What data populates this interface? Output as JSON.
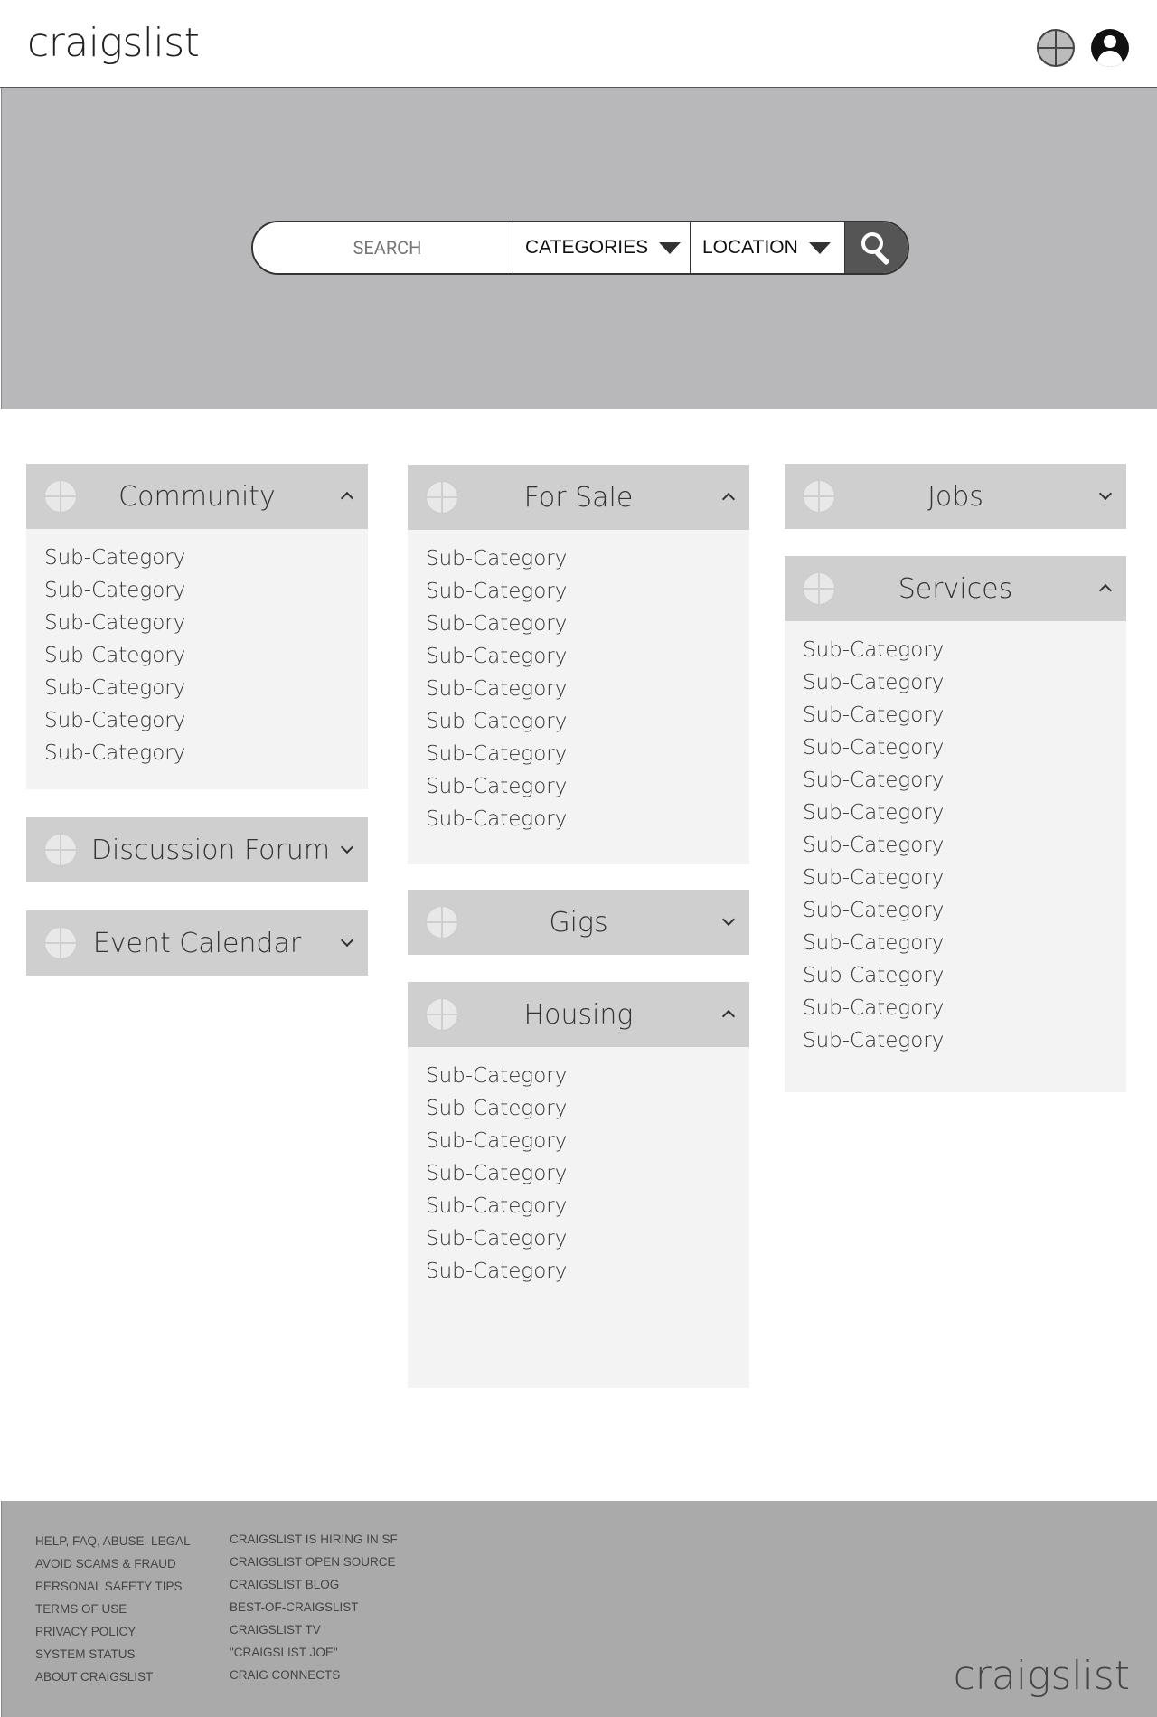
{
  "header": {
    "logo": "craigslist"
  },
  "search": {
    "placeholder": "SEARCH",
    "categories_label": "CATEGORIES",
    "location_label": "LOCATION"
  },
  "panels": {
    "community": {
      "title": "Community",
      "expanded": true,
      "items": [
        "Sub-Category",
        "Sub-Category",
        "Sub-Category",
        "Sub-Category",
        "Sub-Category",
        "Sub-Category",
        "Sub-Category"
      ]
    },
    "discussion_forum": {
      "title": "Discussion Forum",
      "expanded": false
    },
    "event_calendar": {
      "title": "Event Calendar",
      "expanded": false
    },
    "for_sale": {
      "title": "For Sale",
      "expanded": true,
      "items": [
        "Sub-Category",
        "Sub-Category",
        "Sub-Category",
        "Sub-Category",
        "Sub-Category",
        "Sub-Category",
        "Sub-Category",
        "Sub-Category",
        "Sub-Category"
      ]
    },
    "gigs": {
      "title": "Gigs",
      "expanded": false
    },
    "housing": {
      "title": "Housing",
      "expanded": true,
      "items": [
        "Sub-Category",
        "Sub-Category",
        "Sub-Category",
        "Sub-Category",
        "Sub-Category",
        "Sub-Category",
        "Sub-Category"
      ]
    },
    "jobs": {
      "title": "Jobs",
      "expanded": false
    },
    "services": {
      "title": "Services",
      "expanded": true,
      "items": [
        "Sub-Category",
        "Sub-Category",
        "Sub-Category",
        "Sub-Category",
        "Sub-Category",
        "Sub-Category",
        "Sub-Category",
        "Sub-Category",
        "Sub-Category",
        "Sub-Category",
        "Sub-Category",
        "Sub-Category",
        "Sub-Category"
      ]
    }
  },
  "footer": {
    "col1": [
      "HELP, FAQ, ABUSE, LEGAL",
      "AVOID SCAMS & FRAUD",
      "PERSONAL SAFETY TIPS",
      "TERMS OF USE",
      "PRIVACY POLICY",
      "SYSTEM STATUS",
      "ABOUT CRAIGSLIST"
    ],
    "col2": [
      "CRAIGSLIST IS HIRING IN SF",
      "CRAIGSLIST OPEN SOURCE",
      "CRAIGSLIST BLOG",
      "BEST-OF-CRAIGSLIST",
      "CRAIGSLIST TV",
      "\"CRAIGSLIST JOE\"",
      "CRAIG CONNECTS"
    ],
    "logo": "craigslist"
  }
}
